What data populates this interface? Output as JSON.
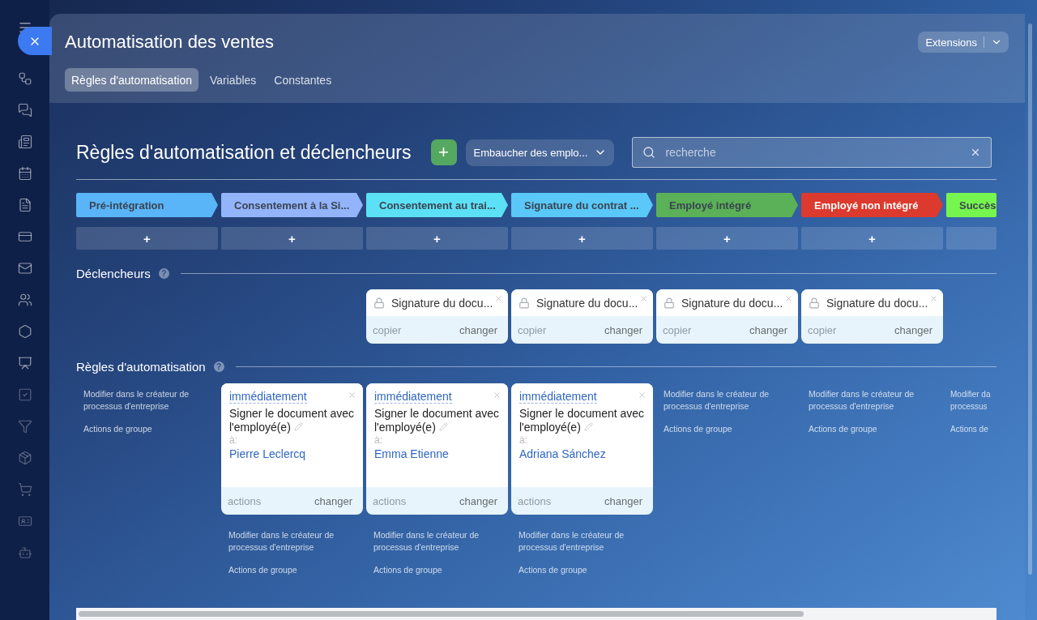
{
  "panel": {
    "title": "Automatisation des ventes",
    "extensions_button": "Extensions",
    "tabs": [
      {
        "label": "Règles d'automatisation",
        "selected": true
      },
      {
        "label": "Variables",
        "selected": false
      },
      {
        "label": "Constantes",
        "selected": false
      }
    ]
  },
  "toolbar": {
    "title": "Règles d'automatisation et déclencheurs",
    "add_button": "+",
    "pipeline_select": "Embaucher des emplo...",
    "search": {
      "placeholder": "recherche"
    }
  },
  "triggers_heading": {
    "title": "Déclencheurs",
    "help": "?"
  },
  "rules_heading": {
    "title": "Règles d'automatisation",
    "help": "?"
  },
  "stages": [
    {
      "name": "Pré-intégration",
      "color": "#5ab4f8",
      "add_button": "+",
      "rule_links": [
        "Modifier dans le créateur de processus d'entreprise",
        "Actions de groupe"
      ]
    },
    {
      "name": "Consentement à la Si...",
      "color": "#93b4fb",
      "add_button": "+",
      "rule": {
        "delay": "immédiatement",
        "action": "Signer le document avec l'employé(e)",
        "to_label": "à:",
        "assignee": "Pierre Leclercq",
        "actions": "actions",
        "change": "changer"
      },
      "rule_links": [
        "Modifier dans le créateur de processus d'entreprise",
        "Actions de groupe"
      ]
    },
    {
      "name": "Consentement au trai...",
      "color": "#5ce0f5",
      "add_button": "+",
      "trigger": {
        "title": "Signature du docu...",
        "copy": "copier",
        "change": "changer"
      },
      "rule": {
        "delay": "immédiatement",
        "action": "Signer le document avec l'employé(e)",
        "to_label": "à:",
        "assignee": "Emma Etienne",
        "actions": "actions",
        "change": "changer"
      },
      "rule_links": [
        "Modifier dans le créateur de processus d'entreprise",
        "Actions de groupe"
      ]
    },
    {
      "name": "Signature du contrat ...",
      "color": "#5ac8f8",
      "add_button": "+",
      "trigger": {
        "title": "Signature du docu...",
        "copy": "copier",
        "change": "changer"
      },
      "rule": {
        "delay": "immédiatement",
        "action": "Signer le document avec l'employé(e)",
        "to_label": "à:",
        "assignee": "Adriana Sánchez",
        "actions": "actions",
        "change": "changer"
      },
      "rule_links": [
        "Modifier dans le créateur de processus d'entreprise",
        "Actions de groupe"
      ]
    },
    {
      "name": "Employé intégré",
      "color": "#5bb157",
      "add_button": "+",
      "trigger": {
        "title": "Signature du docu...",
        "copy": "copier",
        "change": "changer"
      },
      "rule_links": [
        "Modifier dans le créateur de processus d'entreprise",
        "Actions de groupe"
      ]
    },
    {
      "name": "Employé non intégré",
      "color": "#dc3a2e",
      "add_button": "+",
      "trigger": {
        "title": "Signature du docu...",
        "copy": "copier",
        "change": "changer"
      },
      "rule_links": [
        "Modifier dans le créateur de processus d'entreprise",
        "Actions de groupe"
      ]
    },
    {
      "name": "Succès",
      "color": "#77f54f",
      "rule_links": [
        "Modifier da\nprocessus",
        "Actions de"
      ]
    }
  ]
}
